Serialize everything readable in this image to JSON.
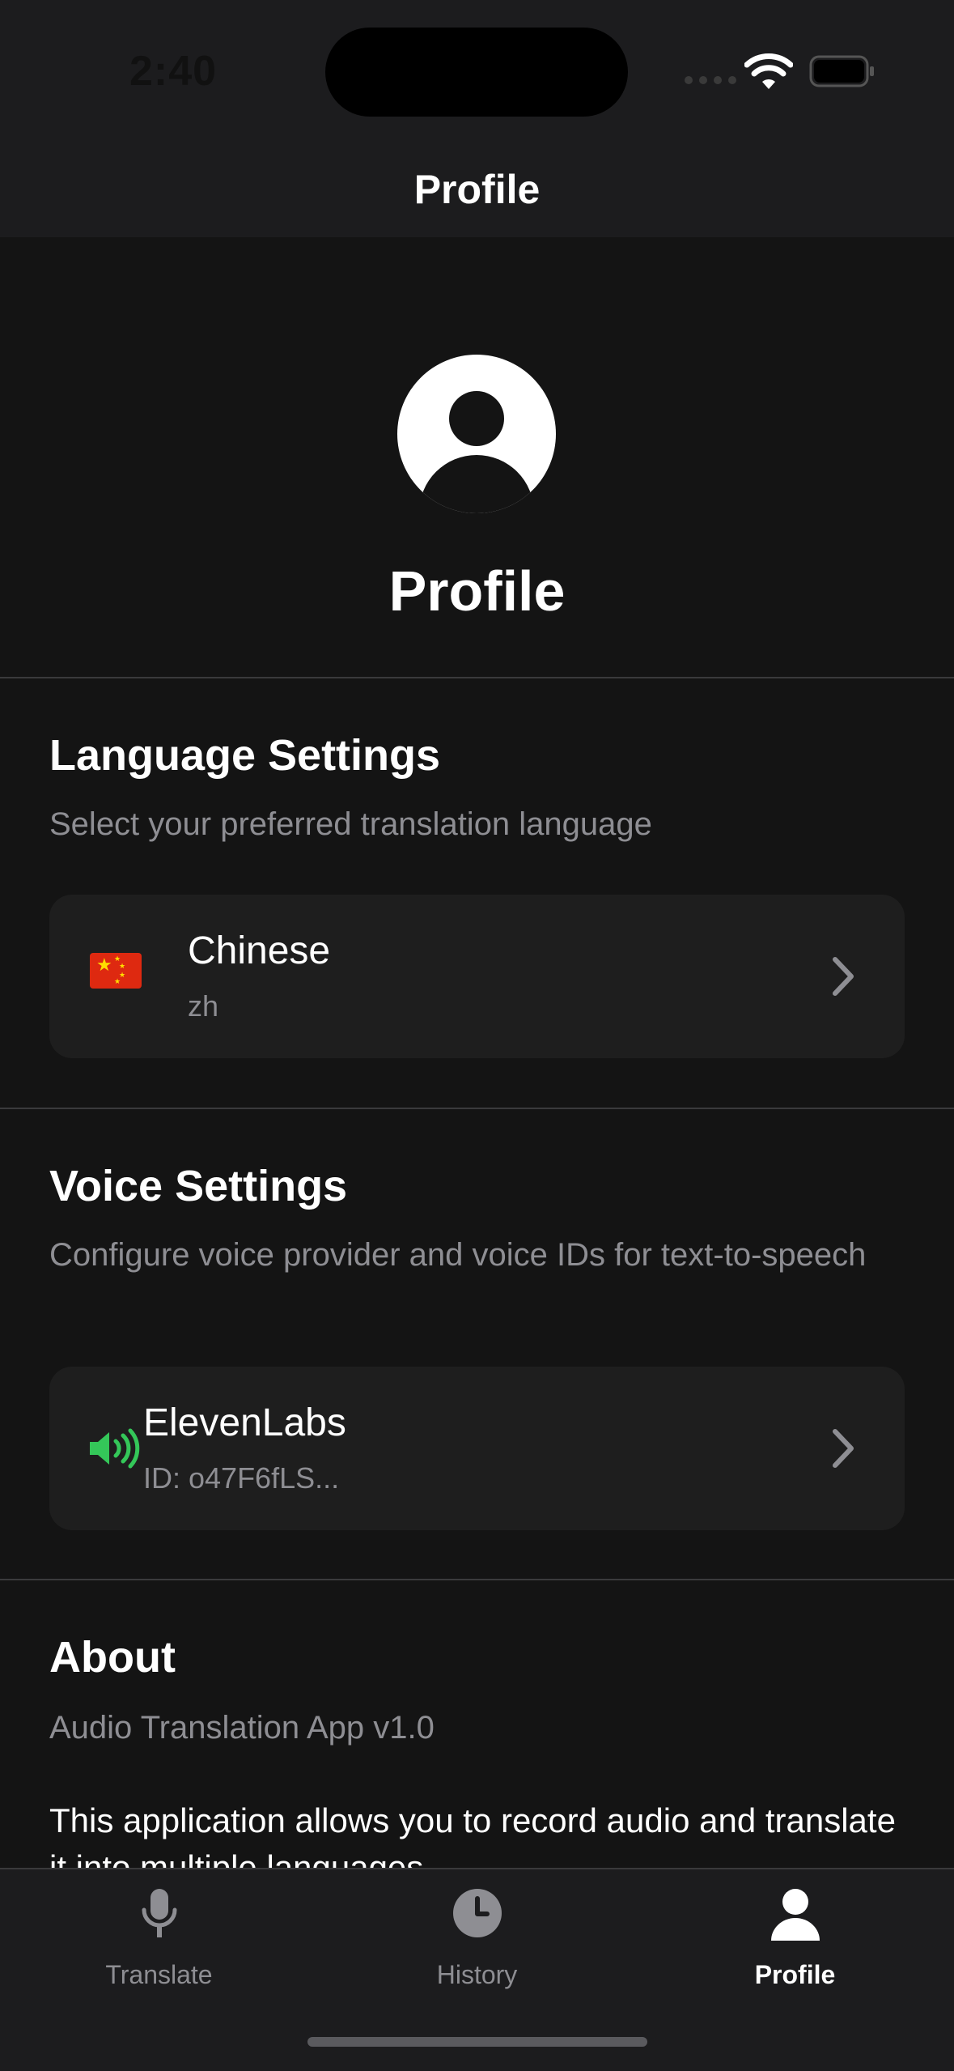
{
  "status_bar": {
    "time": "2:40"
  },
  "nav": {
    "title": "Profile"
  },
  "profile": {
    "name": "Profile"
  },
  "language_settings": {
    "title": "Language Settings",
    "subtitle": "Select your preferred translation language",
    "selected": {
      "flag_icon": "china-flag-icon",
      "name": "Chinese",
      "code": "zh"
    }
  },
  "voice_settings": {
    "title": "Voice Settings",
    "subtitle": "Configure voice provider and voice IDs for text-to-speech",
    "provider": {
      "icon": "speaker-icon",
      "name": "ElevenLabs",
      "id": "ID: o47F6fLS..."
    },
    "icon_color": "#34c759"
  },
  "about": {
    "title": "About",
    "version": "Audio Translation App v1.0",
    "description": "This application allows you to record audio and translate it into multiple languages."
  },
  "tab_bar": {
    "tabs": [
      {
        "label": "Translate",
        "icon": "microphone-icon",
        "active": false
      },
      {
        "label": "History",
        "icon": "clock-icon",
        "active": false
      },
      {
        "label": "Profile",
        "icon": "person-icon",
        "active": true
      }
    ]
  }
}
